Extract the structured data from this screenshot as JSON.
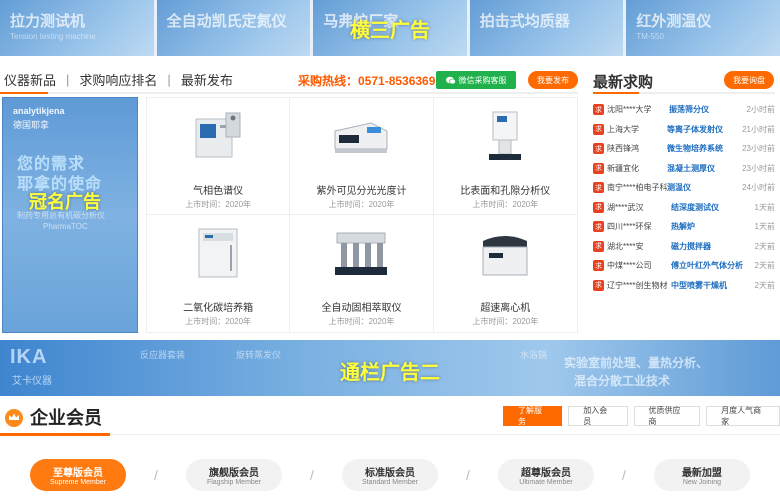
{
  "top_banner": {
    "segments": [
      {
        "title": "拉力测试机",
        "sub": "Tension testing machine"
      },
      {
        "title": "全自动凯氏定氮仪",
        "sub": ""
      },
      {
        "title": "马弗炉厂家",
        "sub": ""
      },
      {
        "title": "拍击式均质器",
        "sub": ""
      },
      {
        "title": "红外测温仪",
        "sub": "TM-550"
      }
    ],
    "ad_label": "横三广告"
  },
  "tabs": {
    "items": [
      "仪器新品",
      "求购响应排名",
      "最新发布"
    ],
    "hotline": "采购热线：0571-85363692",
    "wechat_btn": "微信采购客服",
    "publish_btn": "我要发布"
  },
  "left_ad": {
    "brand": "analytikjena",
    "brand_cn": "德国耶拿",
    "line1": "您的需求",
    "line2": "耶拿的使命",
    "small": "制药专用总有机碳分析仪",
    "small2": "PharmaTOC",
    "ad_label": "冠名广告"
  },
  "products": [
    {
      "name": "气相色谱仪",
      "time": "上市时间：2020年",
      "icon": "gc-instrument"
    },
    {
      "name": "紫外可见分光光度计",
      "time": "上市时间：2020年",
      "icon": "uv-spectrometer"
    },
    {
      "name": "比表面和孔隙分析仪",
      "time": "上市时间：2020年",
      "icon": "surface-analyzer"
    },
    {
      "name": "二氧化碳培养箱",
      "time": "上市时间：2020年",
      "icon": "incubator"
    },
    {
      "name": "全自动固相萃取仪",
      "time": "上市时间：2020年",
      "icon": "spe-instrument"
    },
    {
      "name": "超速离心机",
      "time": "上市时间：2020年",
      "icon": "centrifuge"
    }
  ],
  "requests": {
    "title": "最新求购",
    "btn": "我要询盘",
    "badge": "求",
    "items": [
      {
        "who": "沈阳****大学",
        "what": "振荡筛分仪",
        "when": "2小时前"
      },
      {
        "who": "上海大学",
        "what": "等离子体发射仪",
        "when": "21小时前"
      },
      {
        "who": "陕西锋鸿",
        "what": "微生物培养系统",
        "when": "23小时前"
      },
      {
        "who": "新疆宜化",
        "what": "混凝土测厚仪",
        "when": "23小时前"
      },
      {
        "who": "南宁****柏电子科",
        "what": "测温仪",
        "when": "24小时前"
      },
      {
        "who": "湖****武汉",
        "what": "结深度测试仪",
        "when": "1天前"
      },
      {
        "who": "四川****环保",
        "what": "热解炉",
        "when": "1天前"
      },
      {
        "who": "湖北****安",
        "what": "磁力搅拌器",
        "when": "2天前"
      },
      {
        "who": "中煤****公司",
        "what": "傅立叶红外气体分析",
        "when": "2天前"
      },
      {
        "who": "辽宁****创生物材",
        "what": "中型喷雾干燥机",
        "when": "2天前"
      }
    ]
  },
  "mid_banner": {
    "brand": "IKA",
    "brand_cn": "艾卡仪器",
    "ghost1": "反应器套装",
    "ghost2": "旋转蒸发仪",
    "ghost3": "水浴锅",
    "slogan1": "实验室前处理、量热分析、",
    "slogan2": "混合分散工业技术",
    "ad_label": "通栏广告二"
  },
  "members": {
    "title": "企业会员",
    "buttons": [
      "了解服务",
      "加入会员",
      "优质供应商",
      "月度人气商家"
    ],
    "tiers": [
      {
        "cn": "至尊版会员",
        "en": "Supreme Member"
      },
      {
        "cn": "旗舰版会员",
        "en": "Flagship Member"
      },
      {
        "cn": "标准版会员",
        "en": "Standard Member"
      },
      {
        "cn": "超尊版会员",
        "en": "Ultimate Member"
      },
      {
        "cn": "最新加盟",
        "en": "New Joining"
      }
    ]
  },
  "colors": {
    "accent": "#ff6a00",
    "wechat": "#21b14c",
    "link": "#1f6ebf",
    "badge": "#e8411f"
  }
}
